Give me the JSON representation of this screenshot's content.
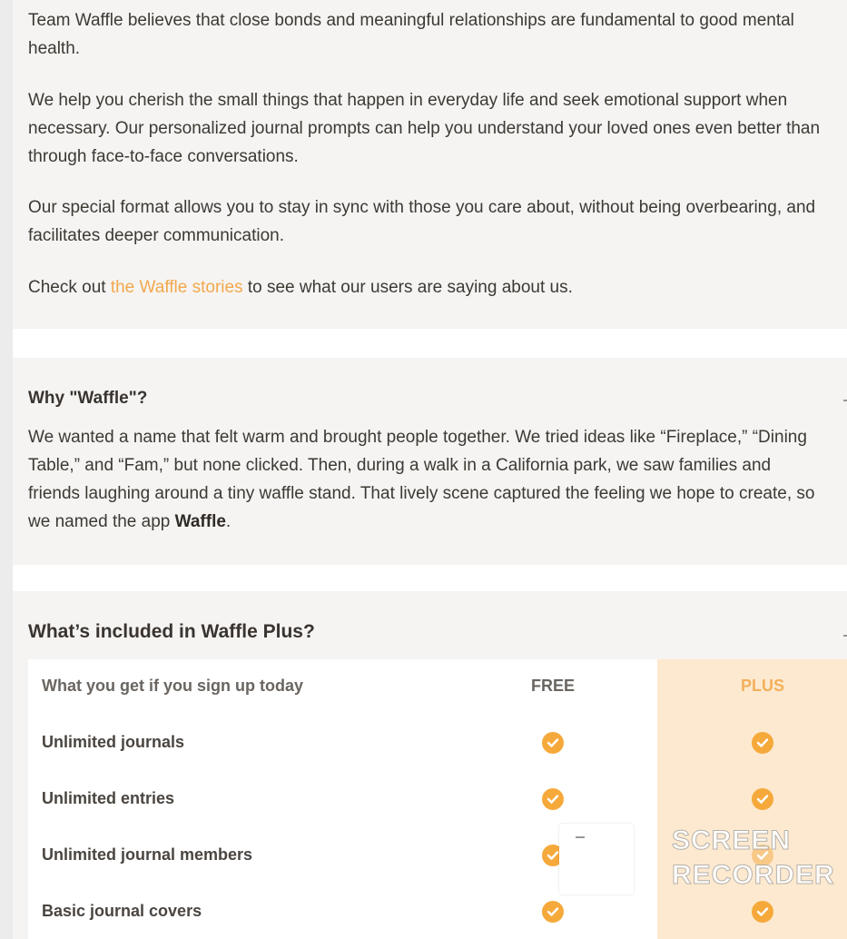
{
  "about": {
    "p1": "Team Waffle believes that close bonds and meaningful relationships are fundamental to good mental health.",
    "p2": "We help you cherish the small things that happen in everyday life and seek emotional support when necessary. Our personalized journal prompts can help you understand your loved ones even better than through face-to-face conversations.",
    "p3": "Our special format allows you to stay in sync with those you care about, without being overbearing, and facilitates deeper communication.",
    "p4_before": "Check out ",
    "p4_link": "the Waffle stories",
    "p4_after": " to see what our users are saying about us."
  },
  "why": {
    "title": "Why \"Waffle\"?",
    "body_before": "We wanted a name that felt warm and brought people together. We tried ideas like “Fireplace,” “Dining Table,” and “Fam,” but none clicked. Then, during a walk in a California park, we saw families and friends laughing around a tiny waffle stand. That lively scene captured the feeling we hope to create, so we named the app ",
    "body_bold": "Waffle",
    "body_after": "."
  },
  "plus": {
    "title": "What’s included in Waffle Plus?",
    "table": {
      "header_label": "What you get if you sign up today",
      "free_title": "FREE",
      "plus_title": "PLUS",
      "rows": [
        {
          "label": "Unlimited journals",
          "free": true,
          "plus": true
        },
        {
          "label": "Unlimited entries",
          "free": true,
          "plus": true
        },
        {
          "label": "Unlimited journal members",
          "free": true,
          "plus": true
        },
        {
          "label": "Basic journal covers",
          "free": true,
          "plus": true
        }
      ]
    }
  },
  "watermark": {
    "line1": "SCREEN",
    "line2": "RECORDER"
  },
  "colors": {
    "accent": "#f6a93b",
    "link": "#f3a84d",
    "plus_column": "#fde9cf",
    "card": "#f5f4f2"
  },
  "icons": {
    "check": "check-circle-icon"
  }
}
